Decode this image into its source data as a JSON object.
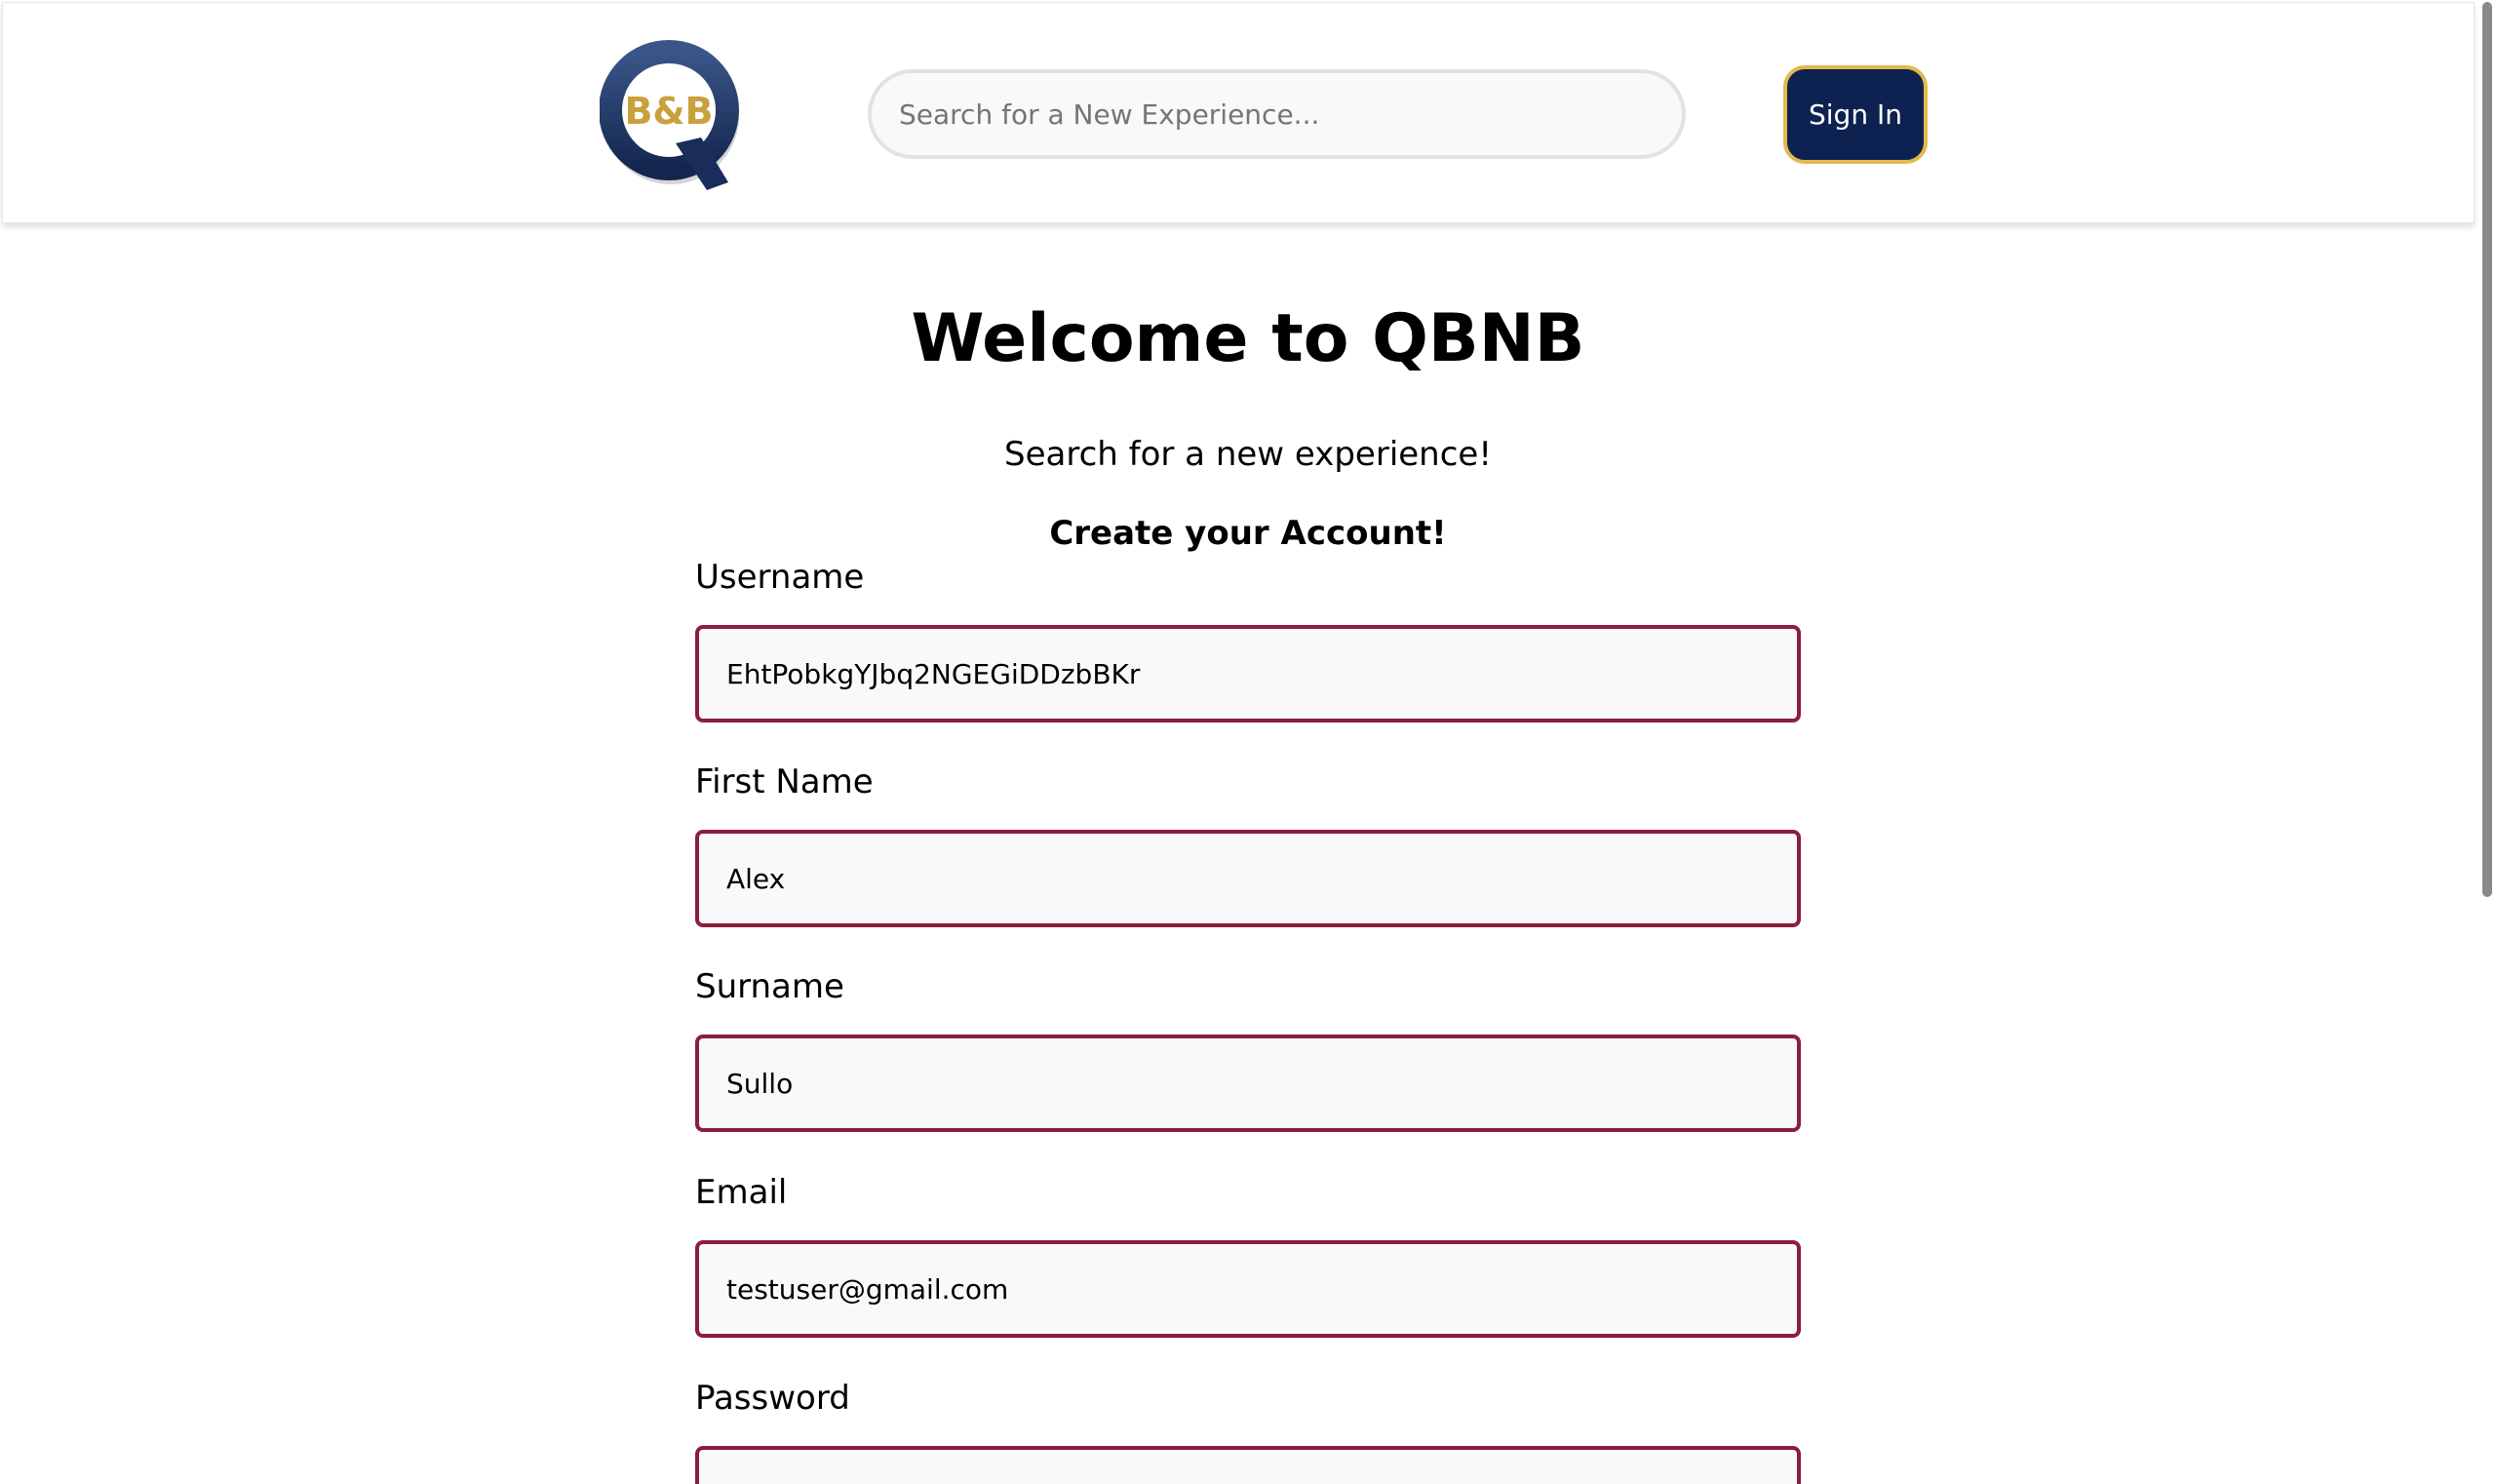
{
  "header": {
    "logo_text": "B&B",
    "search_placeholder": "Search for a New Experience...",
    "signin_label": "Sign In"
  },
  "main": {
    "title": "Welcome to QBNB",
    "subtitle": "Search for a new experience!",
    "form_heading": "Create your Account!"
  },
  "form": {
    "fields": [
      {
        "label": "Username",
        "value": "EhtPobkgYJbq2NGEGiDDzbBKr"
      },
      {
        "label": "First Name",
        "value": "Alex"
      },
      {
        "label": "Surname",
        "value": "Sullo"
      },
      {
        "label": "Email",
        "value": "testuser@gmail.com"
      },
      {
        "label": "Password",
        "value": ""
      }
    ]
  },
  "colors": {
    "primary_navy": "#0e2251",
    "accent_gold": "#e2b94b",
    "input_border_maroon": "#8b1e3a",
    "input_bg": "#f9f9f9"
  },
  "icons": {
    "logo": "qbnb-logo"
  }
}
